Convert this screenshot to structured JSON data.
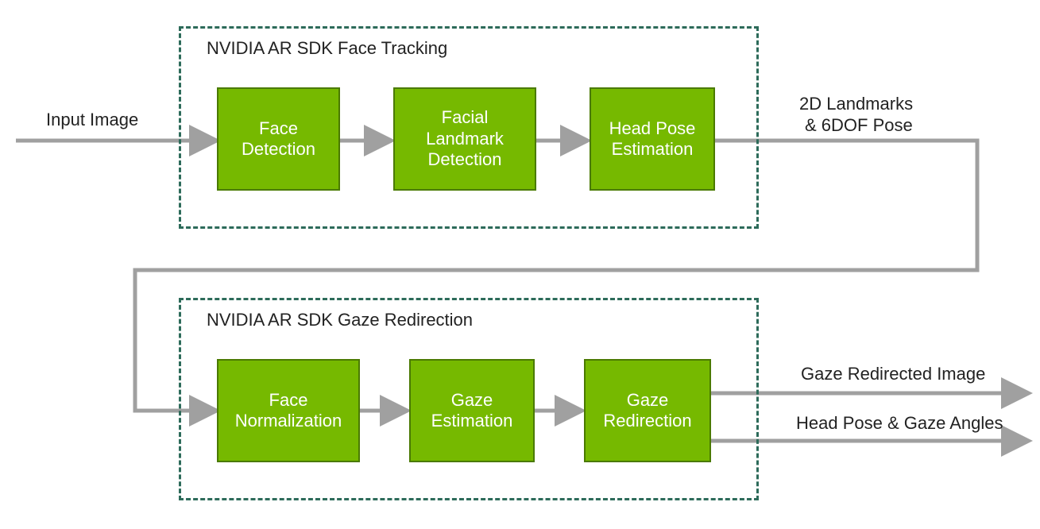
{
  "input_label": "Input Image",
  "container1": {
    "title": "NVIDIA AR SDK Face Tracking",
    "boxes": [
      "Face Detection",
      "Facial Landmark Detection",
      "Head Pose Estimation"
    ]
  },
  "output1_line1": "2D Landmarks",
  "output1_line2": "& 6DOF Pose",
  "container2": {
    "title": "NVIDIA AR SDK Gaze Redirection",
    "boxes": [
      "Face Normalization",
      "Gaze Estimation",
      "Gaze Redirection"
    ]
  },
  "output2a": "Gaze Redirected Image",
  "output2b": "Head Pose & Gaze Angles"
}
